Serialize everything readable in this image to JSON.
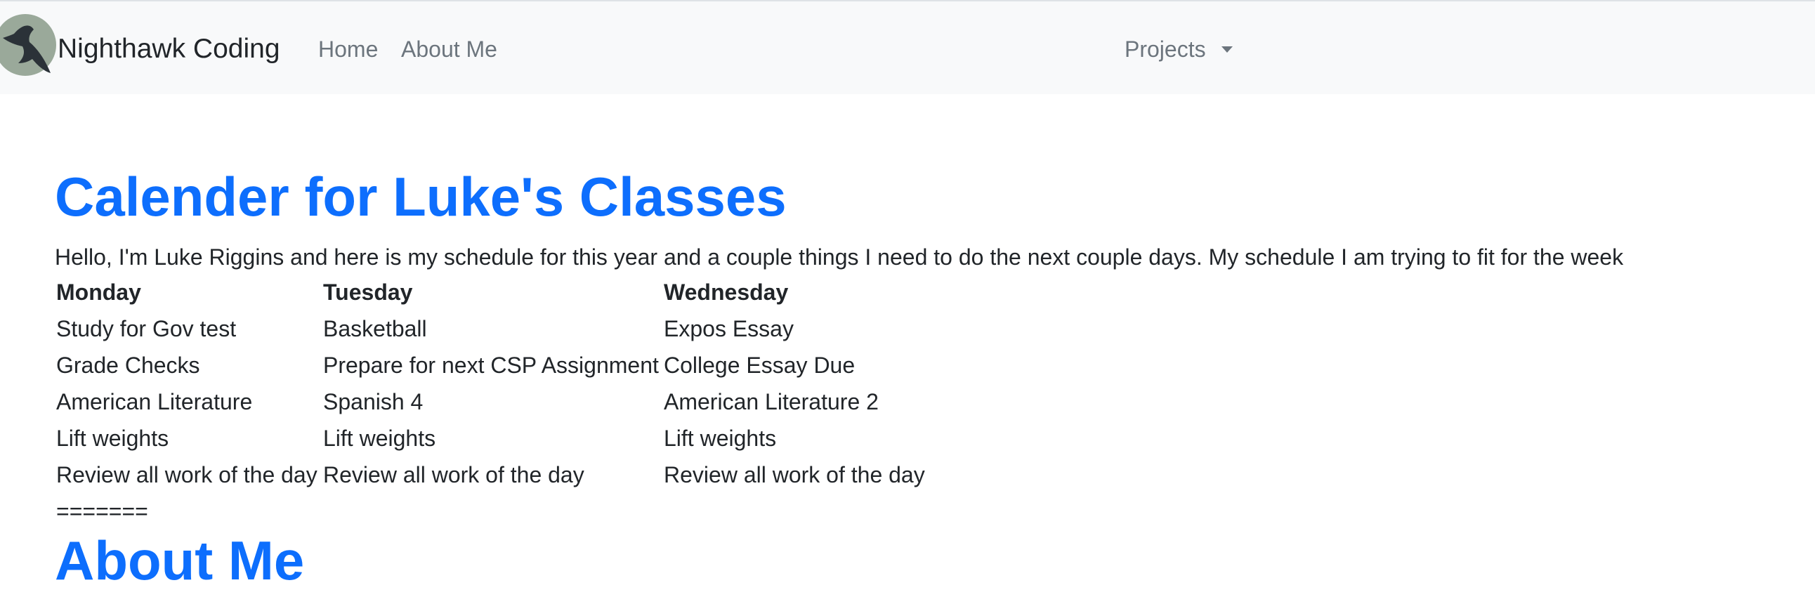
{
  "navbar": {
    "brand": "Nighthawk Coding",
    "links": [
      {
        "label": "Home"
      },
      {
        "label": "About Me"
      }
    ],
    "projects_label": "Projects"
  },
  "main": {
    "title": "Calender for Luke's Classes",
    "intro": "Hello, I'm Luke Riggins and here is my schedule for this year and a couple things I need to do the next couple days. My schedule I am trying to fit for the week",
    "schedule": [
      {
        "day": "Monday",
        "tasks": [
          "Study for Gov test",
          "Grade Checks",
          "American Literature",
          "Lift weights",
          "Review all work of the day"
        ]
      },
      {
        "day": "Tuesday",
        "tasks": [
          "Basketball",
          "Prepare for next CSP Assignment",
          "Spanish 4",
          "Lift weights",
          "Review all work of the day"
        ]
      },
      {
        "day": "Wednesday",
        "tasks": [
          "Expos Essay",
          "College Essay Due",
          "American Literature 2",
          "Lift weights",
          "Review all work of the day"
        ]
      }
    ],
    "divider": "=======",
    "about_heading": "About Me"
  },
  "colors": {
    "accent": "#0d6efd",
    "navbar_bg": "#f8f9fa",
    "nav_link": "#6c757d",
    "text": "#212529",
    "logo_circle": "#9aa99a",
    "logo_bird": "#2b3238"
  },
  "icons": {
    "logo": "nighthawk-bird-logo",
    "dropdown": "caret-down-icon"
  }
}
